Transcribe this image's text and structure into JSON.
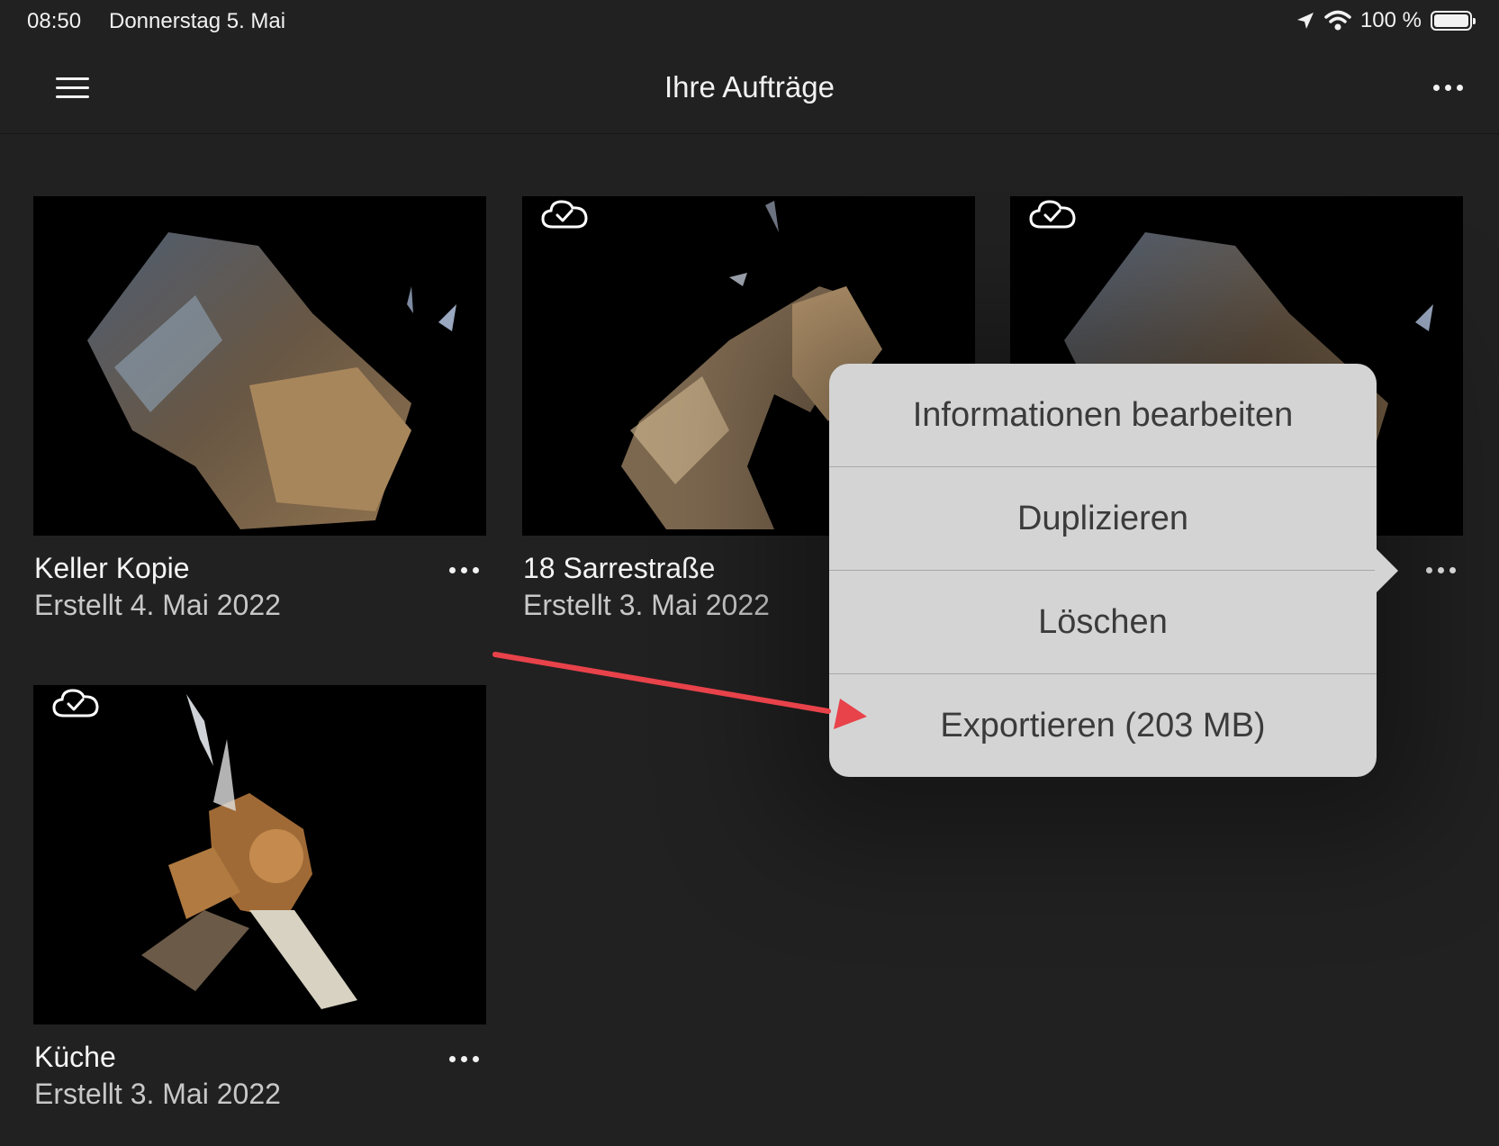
{
  "status_bar": {
    "time": "08:50",
    "date": "Donnerstag 5. Mai",
    "battery_text": "100 %",
    "icons": [
      "location-arrow-icon",
      "wifi-icon",
      "battery-icon"
    ]
  },
  "nav": {
    "title": "Ihre Aufträge",
    "left_icon": "hamburger-menu-icon",
    "right_icon": "more-icon"
  },
  "projects": [
    {
      "title": "Keller Kopie",
      "date": "Erstellt 4. Mai 2022",
      "synced": false
    },
    {
      "title": "18 Sarrestraße",
      "date": "Erstellt 3. Mai 2022",
      "synced": true
    },
    {
      "title": "",
      "date": "",
      "synced": true
    },
    {
      "title": "Küche",
      "date": "Erstellt 3. Mai 2022",
      "synced": true
    }
  ],
  "context_menu": {
    "items": [
      {
        "label": "Informationen bearbeiten"
      },
      {
        "label": "Duplizieren"
      },
      {
        "label": "Löschen"
      },
      {
        "label": "Exportieren (203 MB)"
      }
    ]
  },
  "colors": {
    "background": "#212121",
    "menu_background": "#d4d4d4",
    "annotation_arrow": "#e8424a"
  }
}
